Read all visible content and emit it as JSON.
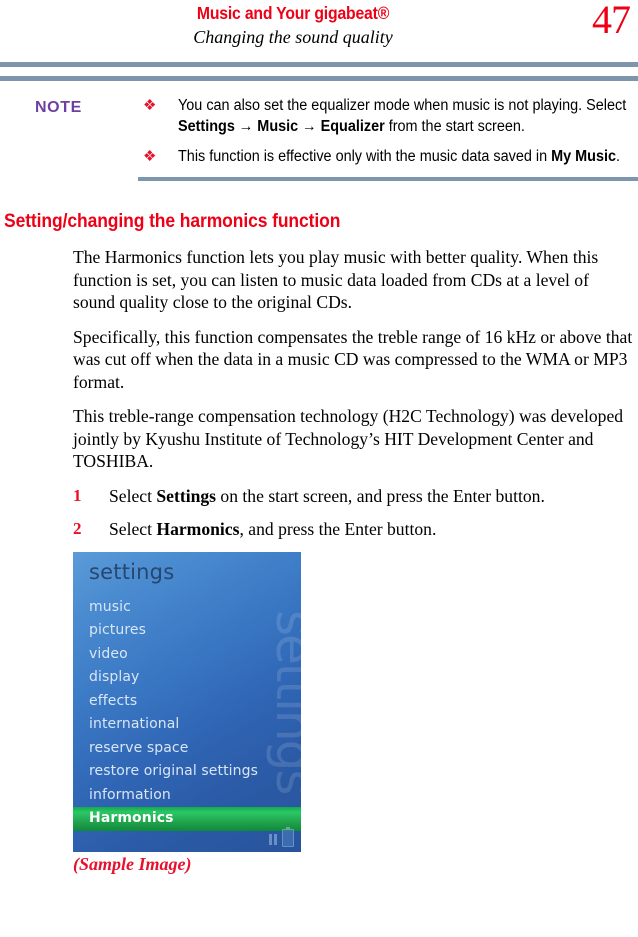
{
  "header": {
    "title": "Music and Your gigabeat®",
    "subtitle": "Changing the sound quality",
    "page_number": "47",
    "title_color": "#ee0016",
    "rule_color": "#7e95ae"
  },
  "note": {
    "label": "NOTE",
    "label_color": "#6e3fa3",
    "bullet_glyph": "❖",
    "bullet_color": "#e8112d",
    "items": [
      {
        "segments": [
          {
            "text": "You can also set the equalizer mode when music is not playing. Select ",
            "bold": false
          },
          {
            "text": "Settings",
            "bold": true
          },
          {
            "text": " → ",
            "bold": false
          },
          {
            "text": "Music",
            "bold": true
          },
          {
            "text": " → ",
            "bold": false
          },
          {
            "text": "Equalizer",
            "bold": true
          },
          {
            "text": " from the start screen.",
            "bold": false
          }
        ]
      },
      {
        "segments": [
          {
            "text": "This function is effective only with the music data saved in ",
            "bold": false
          },
          {
            "text": "My Music",
            "bold": true
          },
          {
            "text": ".",
            "bold": false
          }
        ]
      }
    ]
  },
  "section": {
    "heading": "Setting/changing the harmonics function",
    "heading_color": "#ee0016",
    "paragraphs": [
      "The Harmonics function lets you play music with better quality. When this function is set, you can listen to music data loaded from CDs at a level of sound quality close to the original CDs.",
      "Specifically, this function compensates the treble range of 16 kHz or above that was cut off when the data in a music CD was compressed to the WMA or MP3 format.",
      "This treble-range compensation technology (H2C Technology) was developed jointly by Kyushu Institute of Technology’s HIT Development Center and TOSHIBA."
    ],
    "steps": [
      {
        "number": "1",
        "segments": [
          {
            "text": "Select ",
            "bold": false
          },
          {
            "text": "Settings",
            "bold": true
          },
          {
            "text": " on the start screen, and press the Enter button.",
            "bold": false
          }
        ]
      },
      {
        "number": "2",
        "segments": [
          {
            "text": "Select ",
            "bold": false
          },
          {
            "text": "Harmonics",
            "bold": true
          },
          {
            "text": ", and press the Enter button.",
            "bold": false
          }
        ]
      }
    ]
  },
  "device_screen": {
    "title": "settings",
    "watermark": "settings",
    "highlight_color": "#1f9d49",
    "background_colors": [
      "#5b9bd9",
      "#28549c"
    ],
    "menu_items": [
      {
        "label": "music",
        "selected": false
      },
      {
        "label": "pictures",
        "selected": false
      },
      {
        "label": "video",
        "selected": false
      },
      {
        "label": "display",
        "selected": false
      },
      {
        "label": "effects",
        "selected": false
      },
      {
        "label": "international",
        "selected": false
      },
      {
        "label": "reserve space",
        "selected": false
      },
      {
        "label": "restore original settings",
        "selected": false
      },
      {
        "label": "information",
        "selected": false
      },
      {
        "label": "Harmonics",
        "selected": true
      }
    ],
    "status_icons": [
      "pause-icon",
      "battery-icon"
    ]
  },
  "caption": "(Sample Image)"
}
